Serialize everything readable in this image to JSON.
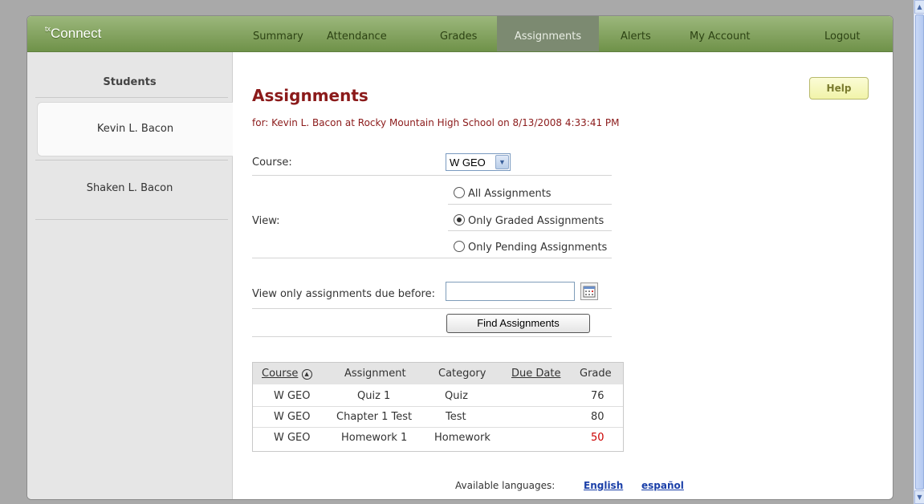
{
  "app": {
    "logo_prefix": "tx",
    "logo_text": "Connect"
  },
  "nav": {
    "summary": "Summary",
    "attendance": "Attendance",
    "grades": "Grades",
    "assignments": "Assignments",
    "alerts": "Alerts",
    "my_account": "My Account",
    "logout": "Logout"
  },
  "sidebar": {
    "heading": "Students",
    "students": [
      "Kevin L. Bacon",
      "Shaken L. Bacon"
    ]
  },
  "page": {
    "title": "Assignments",
    "subtitle": "for: Kevin L. Bacon at Rocky Mountain High School on 8/13/2008 4:33:41 PM",
    "help": "Help"
  },
  "form": {
    "course_label": "Course:",
    "course_value": "W GEO",
    "view_label": "View:",
    "view_options": [
      "All Assignments",
      "Only Graded Assignments",
      "Only Pending Assignments"
    ],
    "view_selected": "Only Graded Assignments",
    "due_label": "View only assignments due before:",
    "due_value": "",
    "find_button": "Find Assignments"
  },
  "table": {
    "headers": [
      "Course",
      "Assignment",
      "Category",
      "Due Date",
      "Grade"
    ],
    "rows": [
      {
        "course": "W GEO",
        "assignment": "Quiz 1",
        "category": "Quiz",
        "due": "",
        "grade": "76"
      },
      {
        "course": "W GEO",
        "assignment": "Chapter 1 Test",
        "category": "Test",
        "due": "",
        "grade": "80"
      },
      {
        "course": "W GEO",
        "assignment": "Homework 1",
        "category": "Homework",
        "due": "",
        "grade": "50"
      }
    ],
    "failing_grade_color": "#cc0000"
  },
  "footer": {
    "label": "Available languages:",
    "languages": [
      "English",
      "español"
    ]
  },
  "colors": {
    "accent_green": "#7b9d58",
    "title_red": "#8b1a1a",
    "link_blue": "#1a3fa8"
  }
}
